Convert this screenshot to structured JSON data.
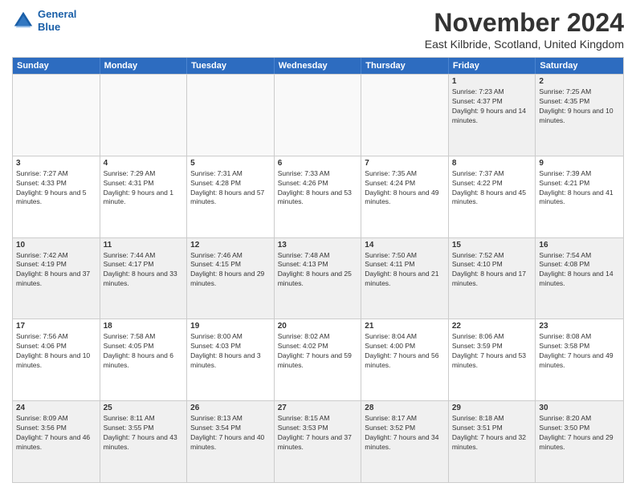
{
  "header": {
    "logo_line1": "General",
    "logo_line2": "Blue",
    "month_title": "November 2024",
    "subtitle": "East Kilbride, Scotland, United Kingdom"
  },
  "days_of_week": [
    "Sunday",
    "Monday",
    "Tuesday",
    "Wednesday",
    "Thursday",
    "Friday",
    "Saturday"
  ],
  "weeks": [
    [
      {
        "day": "",
        "info": "",
        "empty": true
      },
      {
        "day": "",
        "info": "",
        "empty": true
      },
      {
        "day": "",
        "info": "",
        "empty": true
      },
      {
        "day": "",
        "info": "",
        "empty": true
      },
      {
        "day": "",
        "info": "",
        "empty": true
      },
      {
        "day": "1",
        "info": "Sunrise: 7:23 AM\nSunset: 4:37 PM\nDaylight: 9 hours and 14 minutes."
      },
      {
        "day": "2",
        "info": "Sunrise: 7:25 AM\nSunset: 4:35 PM\nDaylight: 9 hours and 10 minutes."
      }
    ],
    [
      {
        "day": "3",
        "info": "Sunrise: 7:27 AM\nSunset: 4:33 PM\nDaylight: 9 hours and 5 minutes."
      },
      {
        "day": "4",
        "info": "Sunrise: 7:29 AM\nSunset: 4:31 PM\nDaylight: 9 hours and 1 minute."
      },
      {
        "day": "5",
        "info": "Sunrise: 7:31 AM\nSunset: 4:28 PM\nDaylight: 8 hours and 57 minutes."
      },
      {
        "day": "6",
        "info": "Sunrise: 7:33 AM\nSunset: 4:26 PM\nDaylight: 8 hours and 53 minutes."
      },
      {
        "day": "7",
        "info": "Sunrise: 7:35 AM\nSunset: 4:24 PM\nDaylight: 8 hours and 49 minutes."
      },
      {
        "day": "8",
        "info": "Sunrise: 7:37 AM\nSunset: 4:22 PM\nDaylight: 8 hours and 45 minutes."
      },
      {
        "day": "9",
        "info": "Sunrise: 7:39 AM\nSunset: 4:21 PM\nDaylight: 8 hours and 41 minutes."
      }
    ],
    [
      {
        "day": "10",
        "info": "Sunrise: 7:42 AM\nSunset: 4:19 PM\nDaylight: 8 hours and 37 minutes."
      },
      {
        "day": "11",
        "info": "Sunrise: 7:44 AM\nSunset: 4:17 PM\nDaylight: 8 hours and 33 minutes."
      },
      {
        "day": "12",
        "info": "Sunrise: 7:46 AM\nSunset: 4:15 PM\nDaylight: 8 hours and 29 minutes."
      },
      {
        "day": "13",
        "info": "Sunrise: 7:48 AM\nSunset: 4:13 PM\nDaylight: 8 hours and 25 minutes."
      },
      {
        "day": "14",
        "info": "Sunrise: 7:50 AM\nSunset: 4:11 PM\nDaylight: 8 hours and 21 minutes."
      },
      {
        "day": "15",
        "info": "Sunrise: 7:52 AM\nSunset: 4:10 PM\nDaylight: 8 hours and 17 minutes."
      },
      {
        "day": "16",
        "info": "Sunrise: 7:54 AM\nSunset: 4:08 PM\nDaylight: 8 hours and 14 minutes."
      }
    ],
    [
      {
        "day": "17",
        "info": "Sunrise: 7:56 AM\nSunset: 4:06 PM\nDaylight: 8 hours and 10 minutes."
      },
      {
        "day": "18",
        "info": "Sunrise: 7:58 AM\nSunset: 4:05 PM\nDaylight: 8 hours and 6 minutes."
      },
      {
        "day": "19",
        "info": "Sunrise: 8:00 AM\nSunset: 4:03 PM\nDaylight: 8 hours and 3 minutes."
      },
      {
        "day": "20",
        "info": "Sunrise: 8:02 AM\nSunset: 4:02 PM\nDaylight: 7 hours and 59 minutes."
      },
      {
        "day": "21",
        "info": "Sunrise: 8:04 AM\nSunset: 4:00 PM\nDaylight: 7 hours and 56 minutes."
      },
      {
        "day": "22",
        "info": "Sunrise: 8:06 AM\nSunset: 3:59 PM\nDaylight: 7 hours and 53 minutes."
      },
      {
        "day": "23",
        "info": "Sunrise: 8:08 AM\nSunset: 3:58 PM\nDaylight: 7 hours and 49 minutes."
      }
    ],
    [
      {
        "day": "24",
        "info": "Sunrise: 8:09 AM\nSunset: 3:56 PM\nDaylight: 7 hours and 46 minutes."
      },
      {
        "day": "25",
        "info": "Sunrise: 8:11 AM\nSunset: 3:55 PM\nDaylight: 7 hours and 43 minutes."
      },
      {
        "day": "26",
        "info": "Sunrise: 8:13 AM\nSunset: 3:54 PM\nDaylight: 7 hours and 40 minutes."
      },
      {
        "day": "27",
        "info": "Sunrise: 8:15 AM\nSunset: 3:53 PM\nDaylight: 7 hours and 37 minutes."
      },
      {
        "day": "28",
        "info": "Sunrise: 8:17 AM\nSunset: 3:52 PM\nDaylight: 7 hours and 34 minutes."
      },
      {
        "day": "29",
        "info": "Sunrise: 8:18 AM\nSunset: 3:51 PM\nDaylight: 7 hours and 32 minutes."
      },
      {
        "day": "30",
        "info": "Sunrise: 8:20 AM\nSunset: 3:50 PM\nDaylight: 7 hours and 29 minutes."
      }
    ]
  ]
}
